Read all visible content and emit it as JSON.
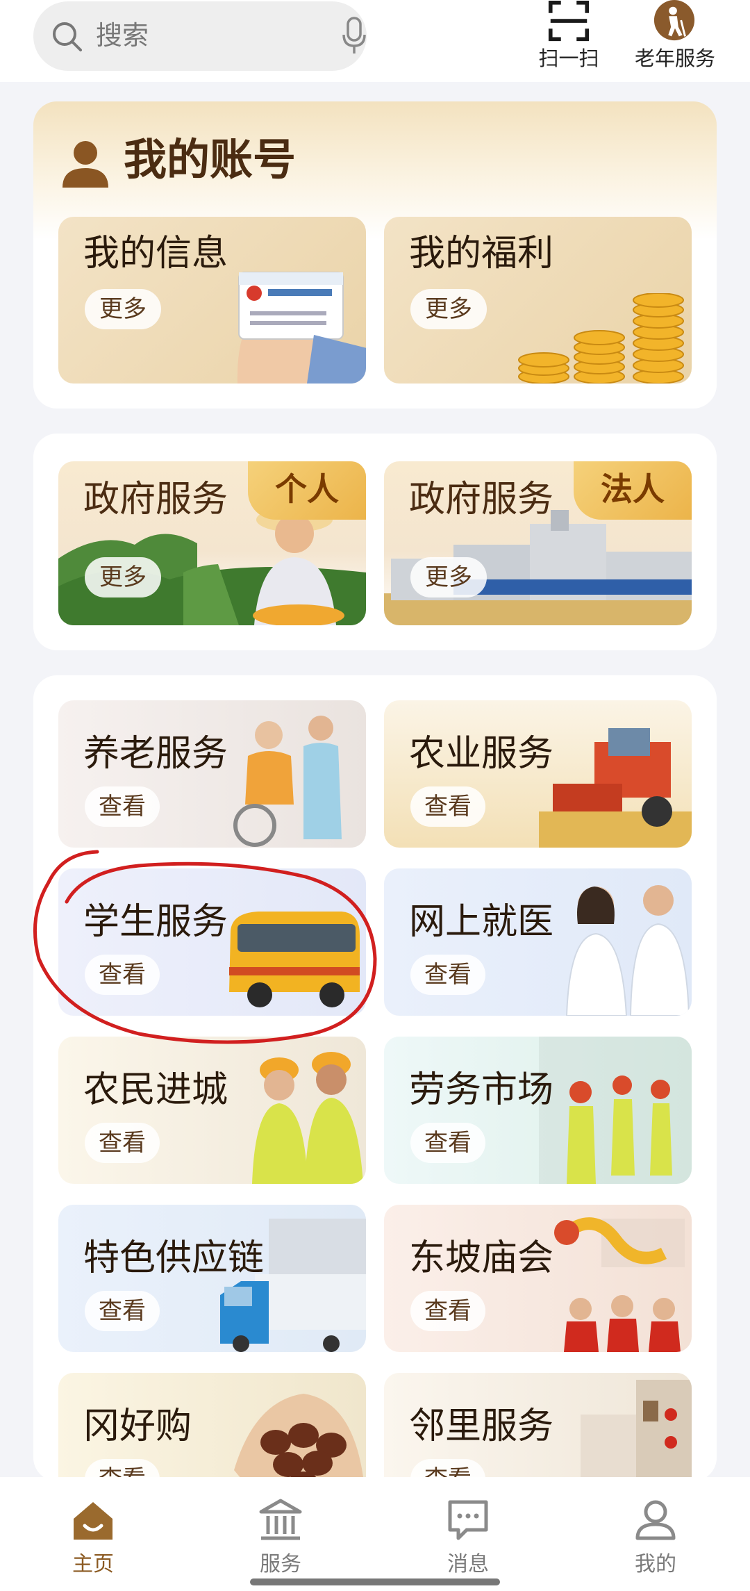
{
  "search": {
    "placeholder": "搜索"
  },
  "top_actions": [
    {
      "label": "扫一扫",
      "icon": "scan-icon"
    },
    {
      "label": "老年服务",
      "icon": "elder-service-icon"
    }
  ],
  "account": {
    "title": "我的账号",
    "tiles": [
      {
        "title": "我的信息",
        "button": "更多"
      },
      {
        "title": "我的福利",
        "button": "更多"
      }
    ]
  },
  "government": {
    "tiles": [
      {
        "title": "政府服务",
        "tag": "个人",
        "button": "更多"
      },
      {
        "title": "政府服务",
        "tag": "法人",
        "button": "更多"
      }
    ]
  },
  "services": [
    {
      "title": "养老服务",
      "button": "查看"
    },
    {
      "title": "农业服务",
      "button": "查看"
    },
    {
      "title": "学生服务",
      "button": "查看"
    },
    {
      "title": "网上就医",
      "button": "查看"
    },
    {
      "title": "农民进城",
      "button": "查看"
    },
    {
      "title": "劳务市场",
      "button": "查看"
    },
    {
      "title": "特色供应链",
      "button": "查看"
    },
    {
      "title": "东坡庙会",
      "button": "查看"
    },
    {
      "title": "冈好购",
      "button": "查看"
    },
    {
      "title": "邻里服务",
      "button": "查看"
    }
  ],
  "tabbar": [
    {
      "label": "主页",
      "icon": "home-icon",
      "active": true
    },
    {
      "label": "服务",
      "icon": "government-building-icon",
      "active": false
    },
    {
      "label": "消息",
      "icon": "message-icon",
      "active": false
    },
    {
      "label": "我的",
      "icon": "profile-icon",
      "active": false
    }
  ],
  "colors": {
    "accent": "#8b5a22",
    "annotation": "#d11f1f"
  }
}
